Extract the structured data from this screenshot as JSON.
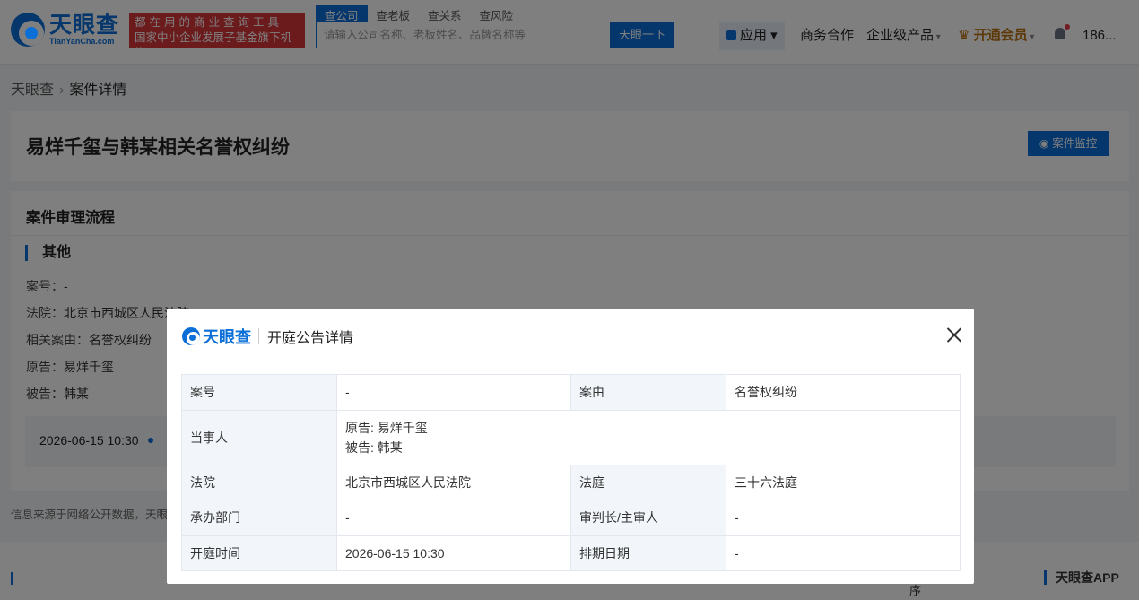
{
  "header": {
    "logo_cn": "天眼查",
    "logo_en": "TianYanCha.com",
    "slogan_line1": "都在用的商业查询工具",
    "slogan_line2": "国家中小企业发展子基金旗下机构",
    "search_tabs": [
      "查公司",
      "查老板",
      "查关系",
      "查风险"
    ],
    "search_placeholder": "请输入公司名称、老板姓名、品牌名称等",
    "search_button": "天眼一下",
    "nav_app": "应用",
    "nav_business": "商务合作",
    "nav_enterprise": "企业级产品",
    "nav_vip": "开通会员",
    "user": "186..."
  },
  "breadcrumb": {
    "home": "天眼查",
    "current": "案件详情"
  },
  "case": {
    "title": "易烊千玺与韩某相关名誉权纠纷",
    "monitor_button": "案件监控"
  },
  "flow": {
    "title": "案件审理流程",
    "section": "其他",
    "lines": [
      {
        "k": "案号：",
        "v": "-"
      },
      {
        "k": "法院：",
        "v": "北京市西城区人民法院"
      },
      {
        "k": "相关案由：",
        "v": "名誉权纠纷"
      },
      {
        "k": "原告：",
        "v": "易烊千玺"
      },
      {
        "k": "被告：",
        "v": "韩某"
      }
    ],
    "timeline_date": "2026-06-15 10:30"
  },
  "source_note": "信息来源于网络公开数据，天眼查",
  "footer": {
    "app": "天眼查APP",
    "seq": "序"
  },
  "modal": {
    "logo": "天眼查",
    "title": "开庭公告详情",
    "rows": {
      "case_no_label": "案号",
      "case_no": "-",
      "cause_label": "案由",
      "cause": "名誉权纠纷",
      "party_label": "当事人",
      "plaintiff": "原告:  易烊千玺",
      "defendant": "被告:  韩某",
      "court_label": "法院",
      "court": "北京市西城区人民法院",
      "courtroom_label": "法庭",
      "courtroom": "三十六法庭",
      "dept_label": "承办部门",
      "dept": "-",
      "judge_label": "审判长/主审人",
      "judge": "-",
      "time_label": "开庭时间",
      "time": "2026-06-15 10:30",
      "schedule_label": "排期日期",
      "schedule": "-"
    }
  }
}
